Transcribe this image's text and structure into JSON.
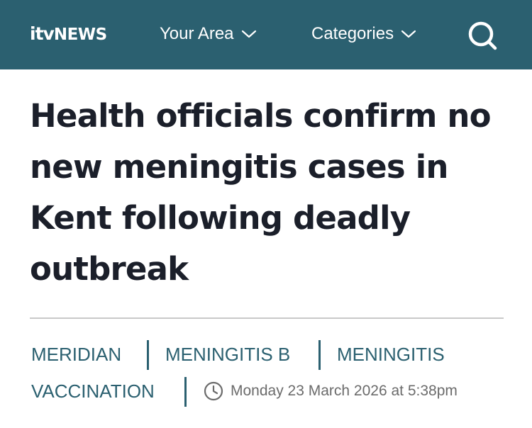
{
  "header": {
    "logo_prefix": "itv",
    "logo_text": "NEWS",
    "nav": [
      {
        "label": "Your Area"
      },
      {
        "label": "Categories"
      }
    ],
    "search_icon": "search-icon",
    "background_color": "#2b6070"
  },
  "article": {
    "headline": "Health officials confirm no new meningitis cases in Kent following deadly outbreak",
    "tags": [
      "MERIDIAN",
      "MENINGITIS B",
      "MENINGITIS",
      "VACCINATION"
    ],
    "published": "Monday 23 March 2026 at 5:38pm",
    "clock_icon": "clock-icon",
    "tag_color": "#2b6070",
    "headline_color": "#1b1f2a"
  }
}
